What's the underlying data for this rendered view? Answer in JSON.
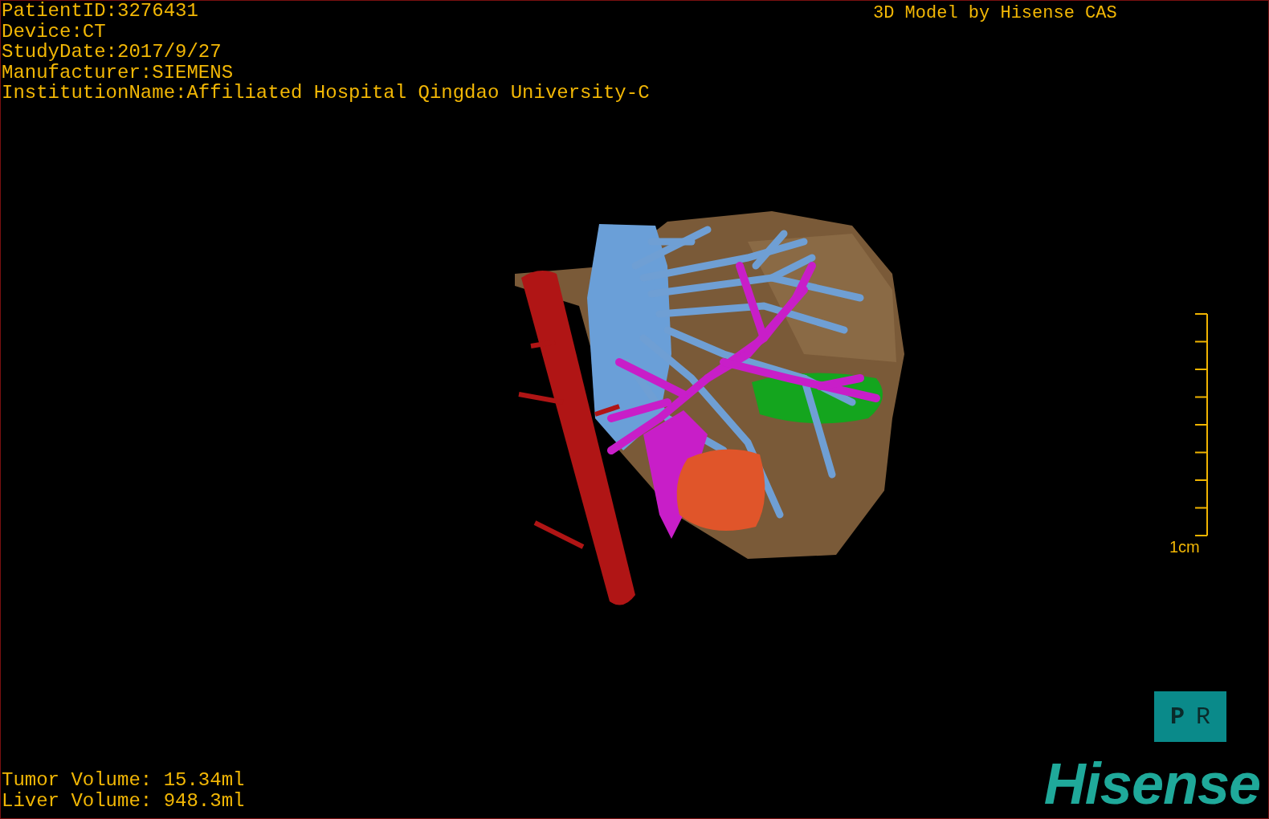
{
  "patient_info": [
    "PatientID:3276431",
    "Device:CT",
    "StudyDate:2017/9/27",
    "Manufacturer:SIEMENS",
    "InstitutionName:Affiliated Hospital Qingdao University-C"
  ],
  "title": "3D Model by Hisense CAS",
  "scale_bar": {
    "label": "1cm"
  },
  "orientation_cube": {
    "faces": [
      {
        "label": "P",
        "kind": "rotated"
      },
      {
        "label": "R",
        "kind": "flipped"
      }
    ]
  },
  "volumes": [
    "Tumor Volume: 15.34ml",
    "Liver Volume: 948.3ml"
  ],
  "logo": "Hisense"
}
